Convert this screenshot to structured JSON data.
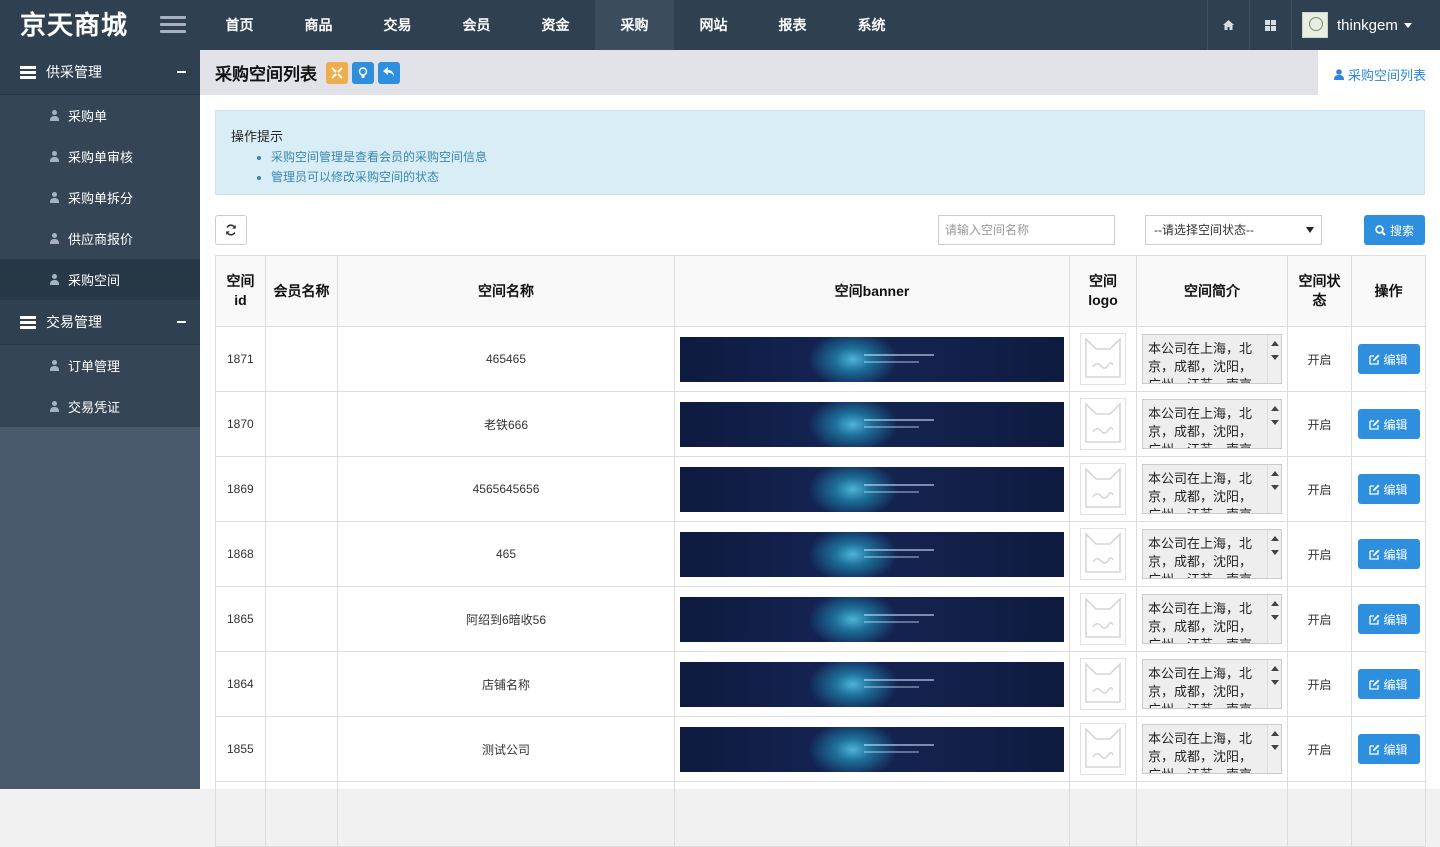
{
  "app": {
    "title": "京天商城"
  },
  "nav": [
    "首页",
    "商品",
    "交易",
    "会员",
    "资金",
    "采购",
    "网站",
    "报表",
    "系统"
  ],
  "nav_active": "采购",
  "topbar": {
    "icons": [
      "home-icon",
      "th-large-icon"
    ],
    "username": "thinkgem"
  },
  "sidebar": {
    "groups": [
      {
        "label": "供采管理",
        "items": [
          "采购单",
          "采购单审核",
          "采购单拆分",
          "供应商报价",
          "采购空间"
        ]
      },
      {
        "label": "交易管理",
        "items": [
          "订单管理",
          "交易凭证"
        ]
      }
    ],
    "active_item": "采购空间"
  },
  "page": {
    "title": "采购空间列表",
    "breadcrumb": "采购空间列表"
  },
  "tips": {
    "title": "操作提示",
    "items": [
      "采购空间管理是查看会员的采购空间信息",
      "管理员可以修改采购空间的状态"
    ]
  },
  "filters": {
    "search_placeholder": "请输入空间名称",
    "status_select": "--请选择空间状态--",
    "search_button": "搜索"
  },
  "table": {
    "headers": [
      "空间id",
      "会员名称",
      "空间名称",
      "空间banner",
      "空间logo",
      "空间简介",
      "空间状态",
      "操作"
    ],
    "rows": [
      {
        "id": "1871",
        "member": "",
        "name": "465465",
        "intro": "本公司在上海，北京，成都，沈阳，广州，江苏，南京等地",
        "status": "开启",
        "action": "编辑"
      },
      {
        "id": "1870",
        "member": "",
        "name": "老铁666",
        "intro": "本公司在上海，北京，成都，沈阳，广州，江苏，南京等地",
        "status": "开启",
        "action": "编辑"
      },
      {
        "id": "1869",
        "member": "",
        "name": "4565645656",
        "intro": "本公司在上海，北京，成都，沈阳，广州，江苏，南京等地",
        "status": "开启",
        "action": "编辑"
      },
      {
        "id": "1868",
        "member": "",
        "name": "465",
        "intro": "本公司在上海，北京，成都，沈阳，广州，江苏，南京等地",
        "status": "开启",
        "action": "编辑"
      },
      {
        "id": "1865",
        "member": "",
        "name": "阿绍到6暗收56",
        "intro": "本公司在上海，北京，成都，沈阳，广州，江苏，南京等地",
        "status": "开启",
        "action": "编辑"
      },
      {
        "id": "1864",
        "member": "",
        "name": "店铺名称",
        "intro": "本公司在上海，北京，成都，沈阳，广州，江苏，南京等地",
        "status": "开启",
        "action": "编辑"
      },
      {
        "id": "1855",
        "member": "",
        "name": "测试公司",
        "intro": "本公司在上海，北京，成都，沈阳，广州，江苏，南京等地",
        "status": "开启",
        "action": "编辑"
      },
      {
        "id": "",
        "member": "",
        "name": "",
        "intro": "",
        "status": "",
        "action": ""
      }
    ]
  },
  "colors": {
    "topbar": "#2f4050",
    "sidebar": "#2f4050",
    "primary": "#2d8fde",
    "tip_bg": "#d9edf7",
    "head_btn_orange": "#f0ad4e",
    "head_btn_blue": "#2d8fde"
  }
}
